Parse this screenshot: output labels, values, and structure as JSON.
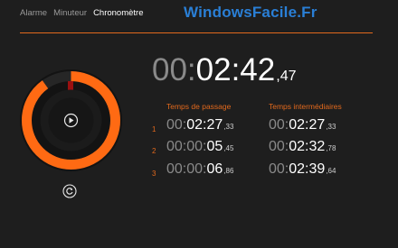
{
  "tabs": [
    "Alarme",
    "Minuteur",
    "Chronomètre"
  ],
  "active_tab": "Chronomètre",
  "watermark": "WindowsFacile.Fr",
  "accent_color": "#e2691d",
  "main_time": {
    "dim": "00:",
    "bright": "02:42",
    "fraction": ",47"
  },
  "laps": {
    "col_passage": "Temps de passage",
    "col_split": "Temps intermédiaires",
    "rows": [
      {
        "index": "1",
        "passage": {
          "dim": "00:",
          "bright": "02:27",
          "fraction": ",33"
        },
        "split": {
          "dim": "00:",
          "bright": "02:27",
          "fraction": ",33"
        }
      },
      {
        "index": "2",
        "passage": {
          "dim": "00:00:",
          "bright": "05",
          "fraction": ",45"
        },
        "split": {
          "dim": "00:",
          "bright": "02:32",
          "fraction": ",78"
        }
      },
      {
        "index": "3",
        "passage": {
          "dim": "00:00:",
          "bright": "06",
          "fraction": ",86"
        },
        "split": {
          "dim": "00:",
          "bright": "02:39",
          "fraction": ",64"
        }
      }
    ]
  },
  "ring_icons": {
    "play": "play-icon",
    "reset": "reset-icon"
  }
}
